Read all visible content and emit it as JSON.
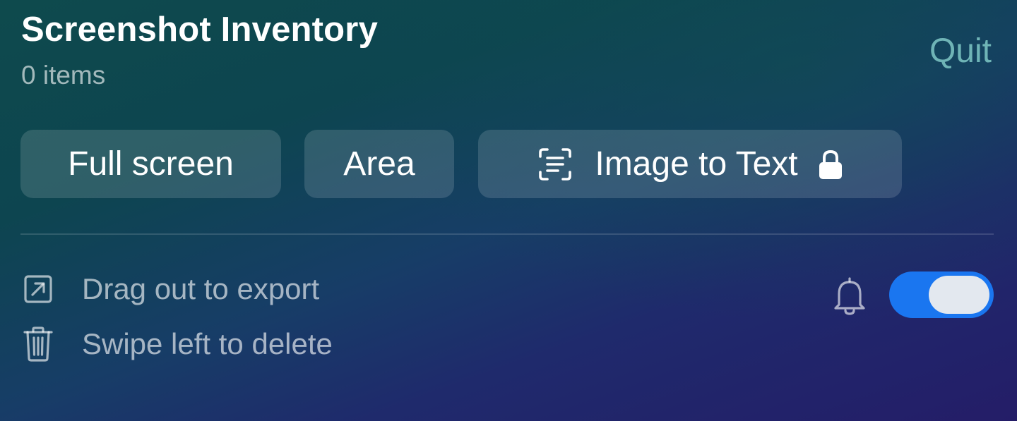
{
  "header": {
    "title": "Screenshot Inventory",
    "item_count": "0 items",
    "quit_label": "Quit"
  },
  "actions": [
    {
      "label": "Full screen"
    },
    {
      "label": "Area"
    },
    {
      "label": "Image to Text",
      "icon": "text-recognition-icon",
      "locked_icon": "lock-icon"
    }
  ],
  "hints": [
    {
      "icon": "export-arrow-icon",
      "text": "Drag out to export"
    },
    {
      "icon": "trash-icon",
      "text": "Swipe left to delete"
    }
  ],
  "notifications": {
    "icon": "bell-icon",
    "enabled": true
  },
  "colors": {
    "accent": "#1a76f0",
    "quit": "#6fb4b6"
  }
}
